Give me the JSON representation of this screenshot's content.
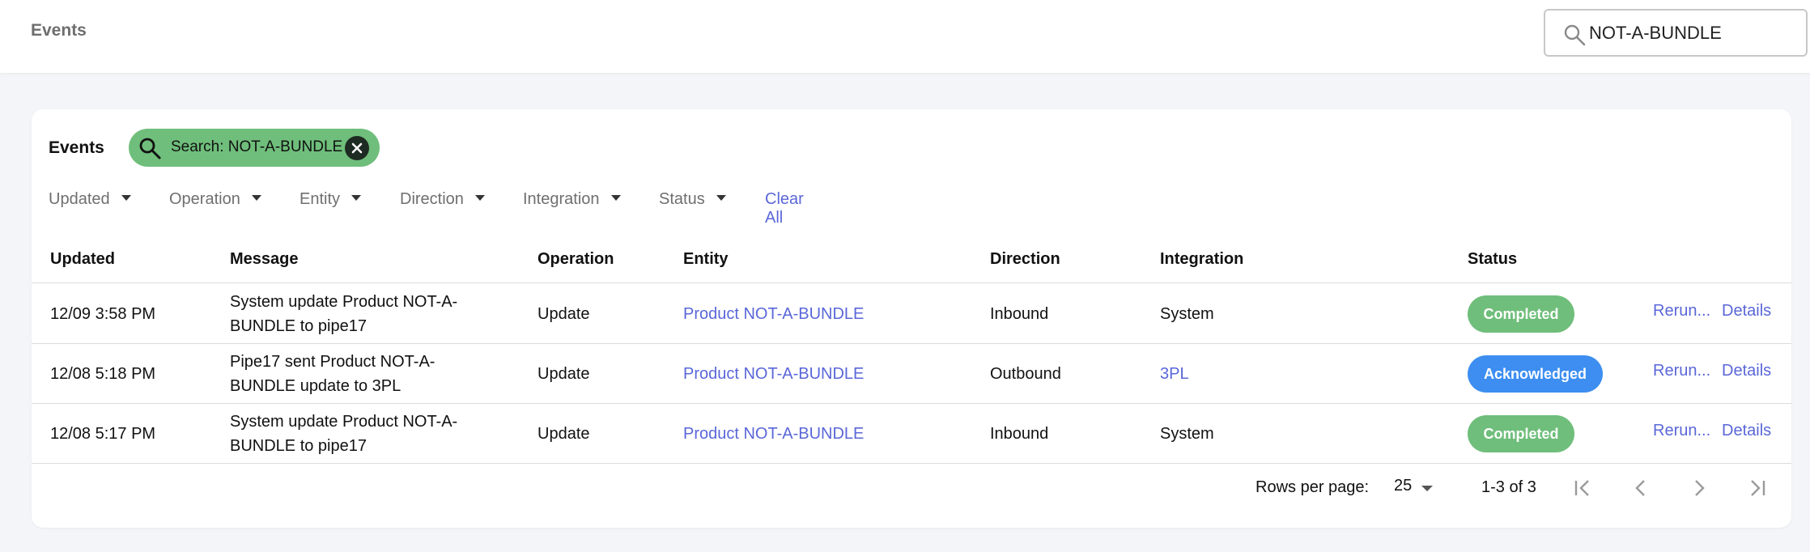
{
  "topbar": {
    "title": "Events",
    "search": {
      "value": "NOT-A-BUNDLE",
      "icon": "search-icon"
    }
  },
  "card": {
    "title": "Events",
    "chip": {
      "label": "Search: NOT-A-BUNDLE",
      "icon": "search-icon",
      "close_icon": "close-icon"
    },
    "filters": [
      "Updated",
      "Operation",
      "Entity",
      "Direction",
      "Integration",
      "Status"
    ],
    "clear_all": "Clear All"
  },
  "table": {
    "headers": {
      "updated": "Updated",
      "message": "Message",
      "operation": "Operation",
      "entity": "Entity",
      "direction": "Direction",
      "integration": "Integration",
      "status": "Status"
    },
    "rows": [
      {
        "updated": "12/09 3:58 PM",
        "message": "System update Product NOT-A-BUNDLE to pipe17",
        "operation": "Update",
        "entity": "Product NOT-A-BUNDLE",
        "direction": "Inbound",
        "integration": "System",
        "status": "Completed",
        "rerun": "Rerun...",
        "details": "Details"
      },
      {
        "updated": "12/08 5:18 PM",
        "message": "Pipe17 sent Product NOT-A-BUNDLE update to 3PL",
        "operation": "Update",
        "entity": "Product NOT-A-BUNDLE",
        "direction": "Outbound",
        "integration": "3PL",
        "status": "Acknowledged",
        "rerun": "Rerun...",
        "details": "Details"
      },
      {
        "updated": "12/08 5:17 PM",
        "message": "System update Product NOT-A-BUNDLE to pipe17",
        "operation": "Update",
        "entity": "Product NOT-A-BUNDLE",
        "direction": "Inbound",
        "integration": "System",
        "status": "Completed",
        "rerun": "Rerun...",
        "details": "Details"
      }
    ]
  },
  "pagination": {
    "rows_per_page_label": "Rows per page:",
    "rows_per_page": "25",
    "range": "1-3 of 3"
  },
  "colors": {
    "accent_link": "#5a67d8",
    "status_completed": "#6fbe7b",
    "status_acknowledged": "#3d8ef0",
    "chip_bg": "#6fbe7b"
  }
}
